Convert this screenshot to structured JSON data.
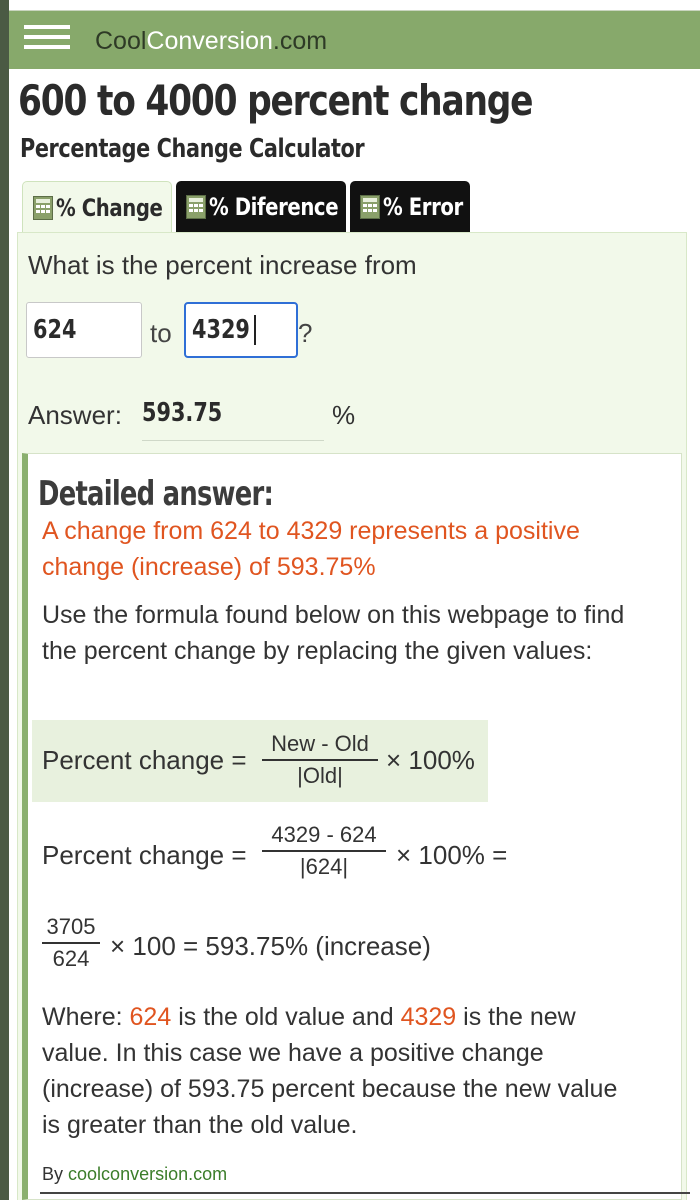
{
  "header": {
    "logo_prefix": "Cool",
    "logo_highlight": "Conversion",
    "logo_suffix": ".com"
  },
  "page": {
    "title": "600 to 4000 percent change",
    "subtitle": "Percentage Change Calculator"
  },
  "tabs": [
    {
      "label": "% Change",
      "active": true
    },
    {
      "label": "% Diference",
      "active": false
    },
    {
      "label": "% Error",
      "active": false
    }
  ],
  "form": {
    "question": "What is the percent increase from",
    "old_value": "624",
    "to_label": "to",
    "new_value": "4329",
    "question_mark": "?",
    "answer_label": "Answer:",
    "answer_value": "593.75",
    "percent_sign": "%"
  },
  "detail": {
    "title": "Detailed answer:",
    "result_text": "A change from 624 to 4329 represents a positive change (increase) of 593.75%",
    "use_formula_text": "Use the formula found below on this webpage to find the percent change by replacing the given values:",
    "formula": {
      "label": "Percent change =",
      "numerator": "New - Old",
      "denominator": "|Old|",
      "multiplier": "× 100%"
    },
    "substitution": {
      "label": "Percent change =",
      "numerator": "4329 - 624",
      "denominator": "|624|",
      "multiplier": "× 100% ="
    },
    "result_line": {
      "numerator": "3705",
      "denominator": "624",
      "text": "× 100 = 593.75% (increase)"
    },
    "where": {
      "prefix": "Where: ",
      "old_value": "624",
      "middle": " is the old value and ",
      "new_value": "4329",
      "suffix": " is the new value. In this case we have a positive change (increase) of 593.75 percent because the new value is greater than the old value."
    }
  },
  "footer": {
    "by_label": "By",
    "by_link": "coolconversion.com"
  },
  "colors": {
    "header_bg": "#87a96b",
    "panel_bg": "#f2f9ea",
    "accent_orange": "#e05520",
    "link_green": "#3b7d2a",
    "focus_blue": "#2f6fd6"
  }
}
